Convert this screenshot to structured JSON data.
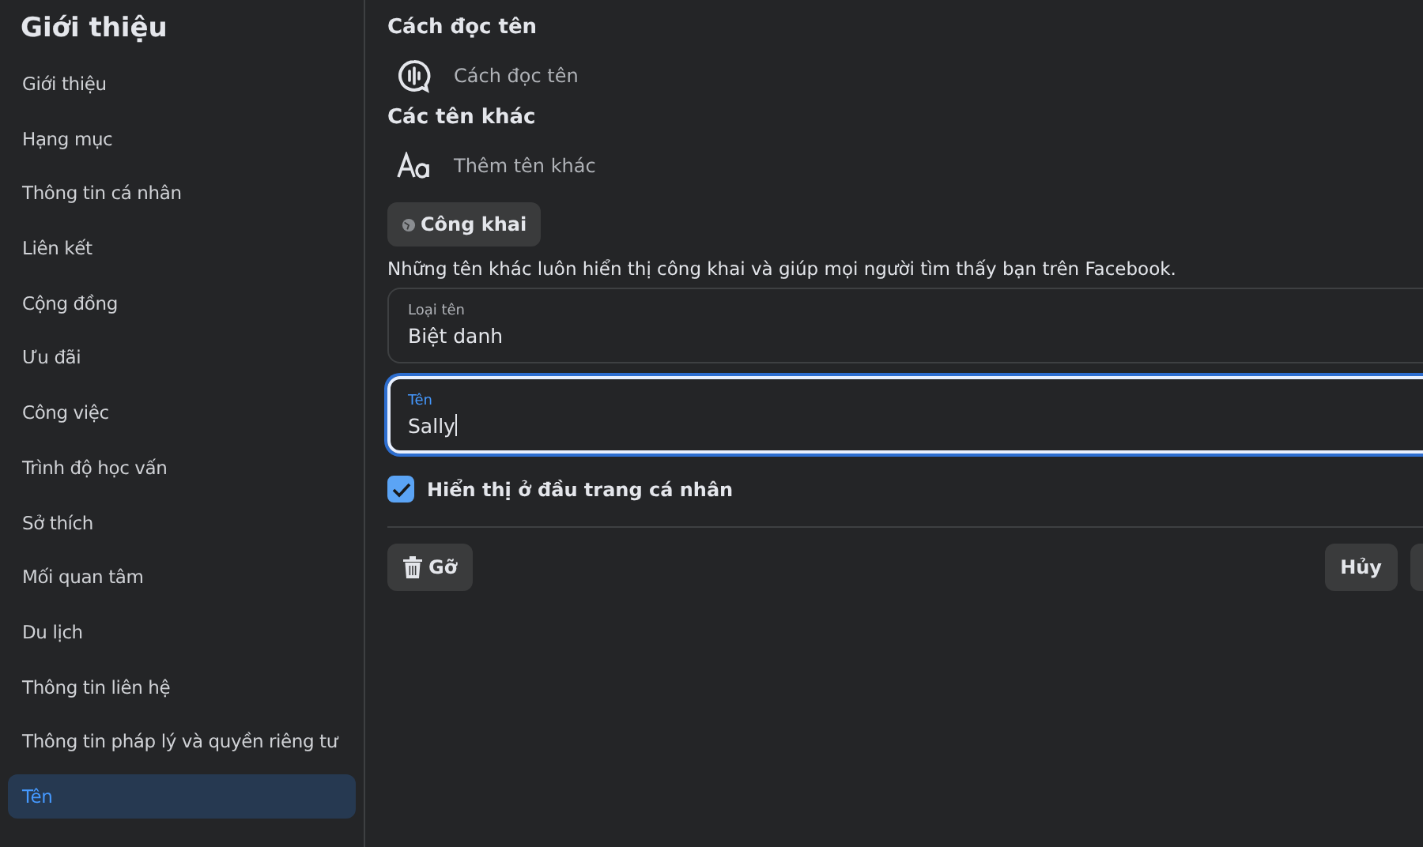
{
  "sidebar": {
    "title": "Giới thiệu",
    "items": [
      {
        "label": "Giới thiệu",
        "selected": false
      },
      {
        "label": "Hạng mục",
        "selected": false
      },
      {
        "label": "Thông tin cá nhân",
        "selected": false
      },
      {
        "label": "Liên kết",
        "selected": false
      },
      {
        "label": "Cộng đồng",
        "selected": false
      },
      {
        "label": "Ưu đãi",
        "selected": false
      },
      {
        "label": "Công việc",
        "selected": false
      },
      {
        "label": "Trình độ học vấn",
        "selected": false
      },
      {
        "label": "Sở thích",
        "selected": false
      },
      {
        "label": "Mối quan tâm",
        "selected": false
      },
      {
        "label": "Du lịch",
        "selected": false
      },
      {
        "label": "Thông tin liên hệ",
        "selected": false
      },
      {
        "label": "Thông tin pháp lý và quyền riêng tư",
        "selected": false
      },
      {
        "label": "Tên",
        "selected": true
      }
    ]
  },
  "pronunciation": {
    "heading": "Cách đọc tên",
    "action": "Cách đọc tên"
  },
  "other_names": {
    "heading": "Các tên khác",
    "action": "Thêm tên khác",
    "audience": "Công khai",
    "description": "Những tên khác luôn hiển thị công khai và giúp mọi người tìm thấy bạn trên Facebook.",
    "fields": [
      {
        "label": "Loại tên",
        "value": "Biệt danh",
        "focused": false
      },
      {
        "label": "Tên",
        "value": "Sally",
        "focused": true
      }
    ],
    "show_at_top": {
      "label": "Hiển thị ở đầu trang cá nhân",
      "checked": true
    },
    "remove_button": "Gỡ",
    "cancel_button": "Hủy"
  }
}
